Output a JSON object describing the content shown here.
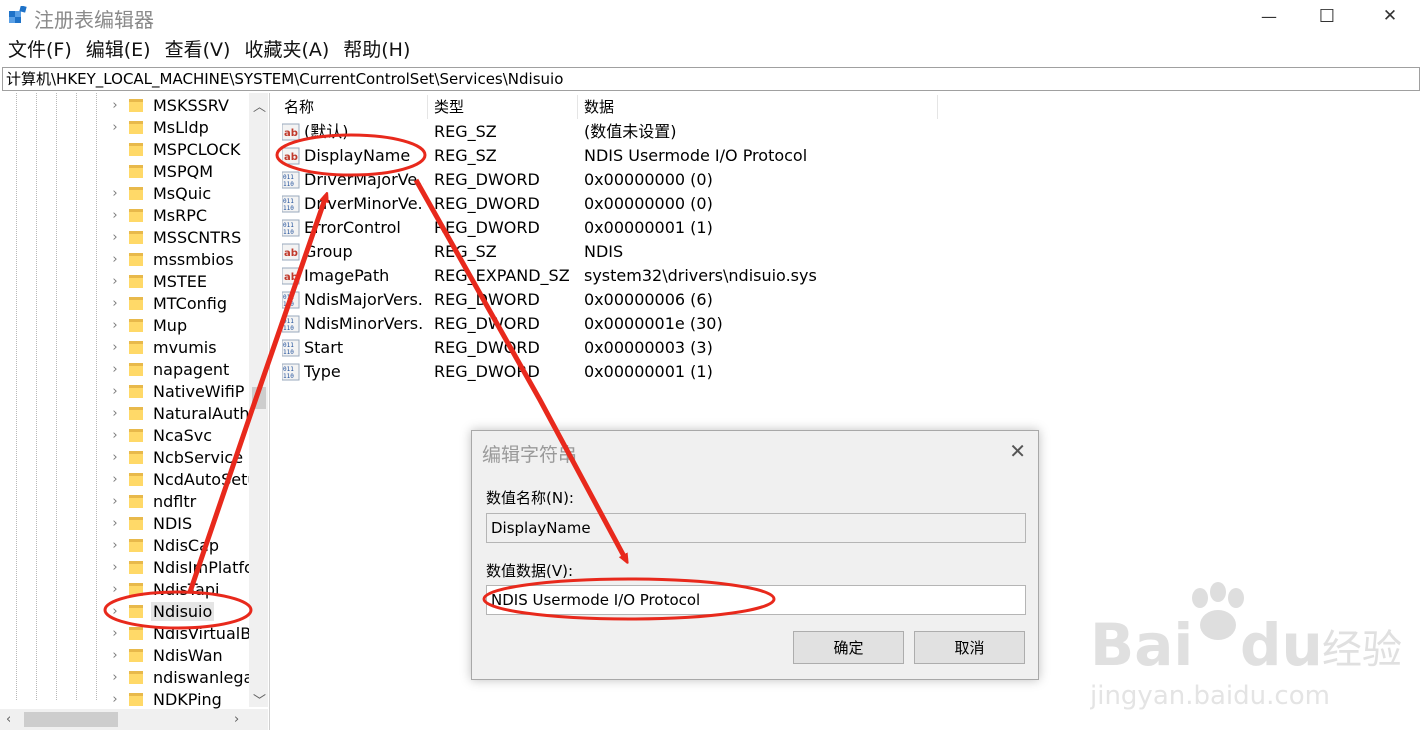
{
  "window": {
    "title": "注册表编辑器",
    "minimize_glyph": "—",
    "maximize_glyph": "☐",
    "close_glyph": "✕"
  },
  "menu": [
    "文件(F)",
    "编辑(E)",
    "查看(V)",
    "收藏夹(A)",
    "帮助(H)"
  ],
  "address": "计算机\\HKEY_LOCAL_MACHINE\\SYSTEM\\CurrentControlSet\\Services\\Ndisuio",
  "tree": {
    "items": [
      {
        "label": "MSKSSRV",
        "expandable": true
      },
      {
        "label": "MsLldp",
        "expandable": true
      },
      {
        "label": "MSPCLOCK",
        "expandable": false
      },
      {
        "label": "MSPQM",
        "expandable": false
      },
      {
        "label": "MsQuic",
        "expandable": true
      },
      {
        "label": "MsRPC",
        "expandable": true
      },
      {
        "label": "MSSCNTRS",
        "expandable": true
      },
      {
        "label": "mssmbios",
        "expandable": true
      },
      {
        "label": "MSTEE",
        "expandable": true
      },
      {
        "label": "MTConfig",
        "expandable": true
      },
      {
        "label": "Mup",
        "expandable": true
      },
      {
        "label": "mvumis",
        "expandable": true
      },
      {
        "label": "napagent",
        "expandable": true
      },
      {
        "label": "NativeWifiP",
        "expandable": true
      },
      {
        "label": "NaturalAuthe",
        "expandable": true
      },
      {
        "label": "NcaSvc",
        "expandable": true
      },
      {
        "label": "NcbService",
        "expandable": true
      },
      {
        "label": "NcdAutoSetu",
        "expandable": true
      },
      {
        "label": "ndfltr",
        "expandable": true
      },
      {
        "label": "NDIS",
        "expandable": true
      },
      {
        "label": "NdisCap",
        "expandable": true
      },
      {
        "label": "NdisImPlatfor",
        "expandable": true
      },
      {
        "label": "NdisTapi",
        "expandable": true
      },
      {
        "label": "Ndisuio",
        "expandable": true,
        "selected": true
      },
      {
        "label": "NdisVirtualBu",
        "expandable": true
      },
      {
        "label": "NdisWan",
        "expandable": true
      },
      {
        "label": "ndiswanlegac",
        "expandable": true
      },
      {
        "label": "NDKPing",
        "expandable": true
      }
    ]
  },
  "list": {
    "columns": [
      "名称",
      "类型",
      "数据"
    ],
    "rows": [
      {
        "name": "(默认)",
        "type": "REG_SZ",
        "data": "(数值未设置)",
        "icon": "string-value-icon"
      },
      {
        "name": "DisplayName",
        "type": "REG_SZ",
        "data": "NDIS Usermode I/O Protocol",
        "icon": "string-value-icon"
      },
      {
        "name": "DriverMajorVe...",
        "type": "REG_DWORD",
        "data": "0x00000000 (0)",
        "icon": "binary-value-icon"
      },
      {
        "name": "DriverMinorVe...",
        "type": "REG_DWORD",
        "data": "0x00000000 (0)",
        "icon": "binary-value-icon"
      },
      {
        "name": "ErrorControl",
        "type": "REG_DWORD",
        "data": "0x00000001 (1)",
        "icon": "binary-value-icon"
      },
      {
        "name": "Group",
        "type": "REG_SZ",
        "data": "NDIS",
        "icon": "string-value-icon"
      },
      {
        "name": "ImagePath",
        "type": "REG_EXPAND_SZ",
        "data": "system32\\drivers\\ndisuio.sys",
        "icon": "string-value-icon"
      },
      {
        "name": "NdisMajorVers...",
        "type": "REG_DWORD",
        "data": "0x00000006 (6)",
        "icon": "binary-value-icon"
      },
      {
        "name": "NdisMinorVers...",
        "type": "REG_DWORD",
        "data": "0x0000001e (30)",
        "icon": "binary-value-icon"
      },
      {
        "name": "Start",
        "type": "REG_DWORD",
        "data": "0x00000003 (3)",
        "icon": "binary-value-icon"
      },
      {
        "name": "Type",
        "type": "REG_DWORD",
        "data": "0x00000001 (1)",
        "icon": "binary-value-icon"
      }
    ]
  },
  "dialog": {
    "title": "编辑字符串",
    "name_label": "数值名称(N):",
    "name_value": "DisplayName",
    "data_label": "数值数据(V):",
    "data_value": "NDIS Usermode I/O Protocol",
    "ok_label": "确定",
    "cancel_label": "取消"
  },
  "watermark": {
    "brand": "Bai du 经验",
    "url": "jingyan.baidu.com"
  },
  "colors": {
    "annotation_red": "#e8291c",
    "folder_yellow": "#ffd968"
  }
}
